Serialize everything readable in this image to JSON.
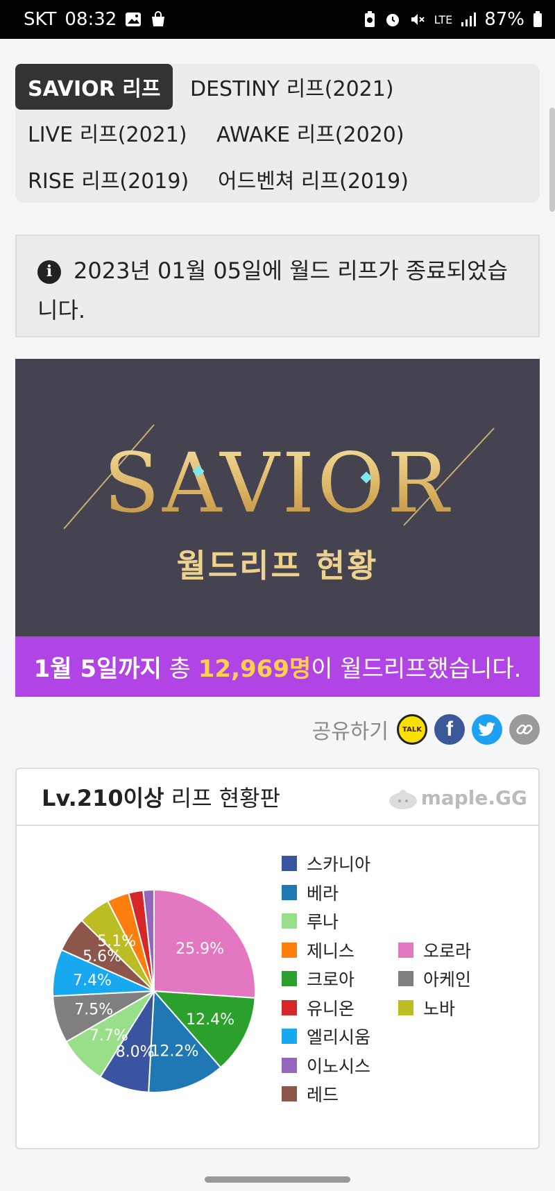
{
  "status_bar": {
    "carrier": "SKT",
    "time": "08:32",
    "network": "LTE",
    "battery": "87%"
  },
  "tabs": [
    {
      "label": "SAVIOR 리프",
      "active": true
    },
    {
      "label": "DESTINY 리프(2021)",
      "active": false
    },
    {
      "label": "LIVE 리프(2021)",
      "active": false
    },
    {
      "label": "AWAKE 리프(2020)",
      "active": false
    },
    {
      "label": "RISE 리프(2019)",
      "active": false
    },
    {
      "label": "어드벤쳐 리프(2019)",
      "active": false
    }
  ],
  "notice": {
    "text": "2023년 01월 05일에 월드 리프가 종료되었습니다."
  },
  "banner": {
    "logo_text": "SAVIOR",
    "subtitle": "월드리프 현황",
    "bar": {
      "date": "1월 5일까지",
      "pre": " 총 ",
      "count": "12,969명",
      "post": "이 월드리프했습니다."
    },
    "bar_color": "#b044e4"
  },
  "share": {
    "label": "공유하기",
    "kakao_label": "TALK",
    "icons": [
      "kakaotalk-icon",
      "facebook-icon",
      "twitter-icon",
      "link-icon"
    ]
  },
  "card": {
    "title_bold": "Lv.210이상",
    "title_rest": " 리프 현황판",
    "watermark": "maple.GG"
  },
  "chart_data": {
    "type": "pie",
    "title": "",
    "slices": [
      {
        "label": "오로라",
        "value": 25.9,
        "color": "#e377c2",
        "value_label": "25.9%"
      },
      {
        "label": "크로아",
        "value": 12.4,
        "color": "#2ca02c",
        "value_label": "12.4%"
      },
      {
        "label": "베라",
        "value": 12.2,
        "color": "#1f77b4",
        "value_label": "12.2%"
      },
      {
        "label": "스카니아",
        "value": 8.0,
        "color": "#3a559f",
        "value_label": "8.0%"
      },
      {
        "label": "루나",
        "value": 7.7,
        "color": "#98df8a",
        "value_label": "7.7%"
      },
      {
        "label": "아케인",
        "value": 7.5,
        "color": "#7f7f7f",
        "value_label": "7.5%"
      },
      {
        "label": "엘리시움",
        "value": 7.4,
        "color": "#17a8f0",
        "value_label": "7.4%"
      },
      {
        "label": "레드",
        "value": 5.6,
        "color": "#8c564b",
        "value_label": "5.6%"
      },
      {
        "label": "노바",
        "value": 5.1,
        "color": "#bcbd22",
        "value_label": "5.1%"
      },
      {
        "label": "제니스",
        "value": 3.5,
        "color": "#ff7f0e",
        "value_label": ""
      },
      {
        "label": "유니온",
        "value": 2.3,
        "color": "#d62728",
        "value_label": ""
      },
      {
        "label": "이노시스",
        "value": 1.7,
        "color": "#9467bd",
        "value_label": ""
      }
    ],
    "legend": {
      "placement": "right",
      "columns": [
        [
          "스카니아",
          "베라",
          "루나",
          "제니스",
          "크로아",
          "유니온",
          "엘리시움",
          "이노시스",
          "레드"
        ],
        [
          "오로라",
          "아케인",
          "노바"
        ]
      ],
      "column2_start_row": 3
    }
  }
}
